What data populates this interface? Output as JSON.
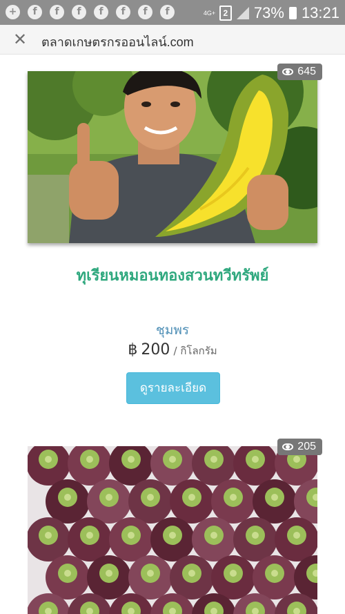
{
  "status_bar": {
    "notification_icons": [
      "messenger-icon",
      "facebook-icon",
      "facebook-icon",
      "facebook-icon",
      "facebook-icon",
      "facebook-icon",
      "facebook-icon",
      "facebook-icon"
    ],
    "network": "4G+",
    "sim": "2",
    "battery": "73%",
    "time": "13:21"
  },
  "browser": {
    "url": "ตลาดเกษตรกรออนไลน์.com"
  },
  "products": [
    {
      "views": "645",
      "title": "ทุเรียนหมอนทองสวนทวีทรัพย์",
      "seller": "ชุมพร",
      "currency": "฿",
      "price": "200",
      "unit": "/ กิโลกรัม",
      "button": "ดูรายละเอียด"
    },
    {
      "views": "205"
    }
  ]
}
